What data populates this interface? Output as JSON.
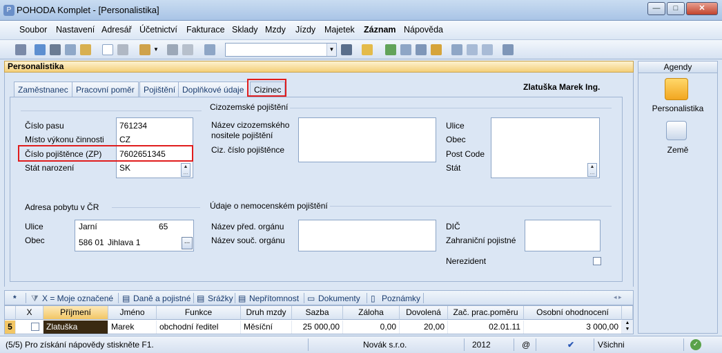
{
  "window": {
    "title": "POHODA Komplet - [Personalistika]",
    "minimize": "—",
    "maximize": "□",
    "close": "✕"
  },
  "menu": [
    "Soubor",
    "Nastavení",
    "Adresář",
    "Účetnictví",
    "Fakturace",
    "Sklady",
    "Mzdy",
    "Jízdy",
    "Majetek",
    "Záznam",
    "Nápověda"
  ],
  "panel": {
    "title": "Personalistika"
  },
  "tabs": [
    "Zaměstnanec",
    "Pracovní poměr",
    "Pojištění",
    "Doplňkové údaje",
    "Cizinec"
  ],
  "person_name": "Zlatuška Marek Ing.",
  "left": {
    "labels": {
      "passport": "Číslo pasu",
      "workplace": "Místo výkonu činnosti",
      "insured_no": "Číslo pojištěnce (ZP)",
      "birth_state": "Stát narození"
    },
    "values": {
      "passport": "761234",
      "workplace": "CZ",
      "insured_no": "7602651345",
      "birth_state": "SK"
    }
  },
  "address": {
    "title": "Adresa pobytu v ČR",
    "street_label": "Ulice",
    "city_label": "Obec",
    "street": "Jarní",
    "number": "65",
    "zip": "586 01",
    "city": "Jihlava 1"
  },
  "foreign_insurance": {
    "title": "Cizozemské pojištění",
    "name_label": "Název cizozemského nositele pojištění",
    "no_label": "Ciz. číslo pojištěnce",
    "street_label": "Ulice",
    "city_label": "Obec",
    "postcode_label": "Post Code",
    "state_label": "Stát"
  },
  "sick": {
    "title": "Údaje o nemocenském pojištění",
    "prev_label": "Název před. orgánu",
    "curr_label": "Název souč. orgánu",
    "dic_label": "DIČ",
    "foreign_insurer_label": "Zahraniční pojistné",
    "nonresident_label": "Nerezident"
  },
  "agenda": {
    "title": "Agendy",
    "items": [
      "Personalistika",
      "Země"
    ]
  },
  "subtabs": [
    "*",
    "X = Moje označené",
    "Daně a pojistné",
    "Srážky",
    "Nepřítomnost",
    "Dokumenty",
    "Poznámky"
  ],
  "grid": {
    "headers": [
      "X",
      "Příjmení",
      "Jméno",
      "Funkce",
      "Druh mzdy",
      "Sazba",
      "Záloha",
      "Dovolená",
      "Zač. prac.poměru",
      "Osobní ohodnocení"
    ],
    "row": {
      "index": "5",
      "surname": "Zlatuška",
      "name": "Marek",
      "function": "obchodní ředitel",
      "wage_type": "Měsíční",
      "rate": "25 000,00",
      "advance": "0,00",
      "vacation": "20,00",
      "start": "02.01.11",
      "bonus": "3 000,00"
    }
  },
  "status": {
    "help": "(5/5) Pro získání nápovědy stiskněte F1.",
    "company": "Novák s.r.o.",
    "year": "2012",
    "at": "@",
    "filter": "Všichni"
  },
  "colors": {
    "highlight": "#e01c1c",
    "panel_title": "#f4cf79",
    "background": "#dbe6f4"
  }
}
